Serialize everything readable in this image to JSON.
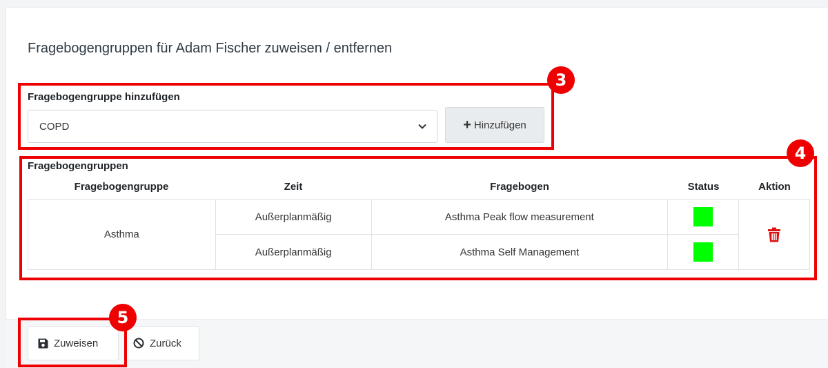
{
  "page": {
    "title": "Fragebogengruppen für Adam Fischer zuweisen / entfernen"
  },
  "add_group": {
    "label": "Fragebogengruppe hinzufügen",
    "selected": "COPD",
    "add_button": "Hinzufügen"
  },
  "groups": {
    "label": "Fragebogengruppen",
    "columns": [
      "Fragebogengruppe",
      "Zeit",
      "Fragebogen",
      "Status",
      "Aktion"
    ],
    "rows": [
      {
        "group": "Asthma",
        "time": "Außerplanmäßig",
        "questionnaire": "Asthma Peak flow measurement",
        "status_color": "#00ff00"
      },
      {
        "group": "Asthma",
        "time": "Außerplanmäßig",
        "questionnaire": "Asthma Self Management",
        "status_color": "#00ff00"
      }
    ]
  },
  "footer": {
    "save_label": "Zuweisen",
    "back_label": "Zurück"
  },
  "annotations": {
    "badge_3": "3",
    "badge_4": "4",
    "badge_5": "5"
  },
  "colors": {
    "annotation_red": "#ee0000",
    "status_green": "#00ff00",
    "trash_red": "#dd1111"
  }
}
